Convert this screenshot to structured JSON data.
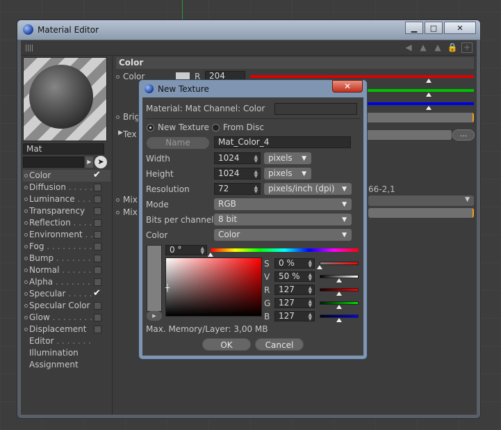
{
  "window": {
    "title": "Material Editor",
    "minimize_label": "▁",
    "maximize_label": "□",
    "close_label": "✕"
  },
  "material": {
    "name": "Mat",
    "channels": [
      {
        "label": "Color",
        "dots": "",
        "checkbox": true,
        "checked": true,
        "selected": true
      },
      {
        "label": "Diffusion",
        "dots": " . . . . . .",
        "checkbox": true,
        "checked": false
      },
      {
        "label": "Luminance",
        "dots": " . . . .",
        "checkbox": true,
        "checked": false
      },
      {
        "label": "Transparency",
        "dots": "",
        "checkbox": true,
        "checked": false
      },
      {
        "label": "Reflection",
        "dots": " . . . .",
        "checkbox": true,
        "checked": false
      },
      {
        "label": "Environment",
        "dots": " . .",
        "checkbox": true,
        "checked": false
      },
      {
        "label": "Fog",
        "dots": " . . . . . . . . .",
        "checkbox": true,
        "checked": false
      },
      {
        "label": "Bump",
        "dots": " . . . . . . .",
        "checkbox": true,
        "checked": false
      },
      {
        "label": "Normal",
        "dots": " . . . . . .",
        "checkbox": true,
        "checked": false
      },
      {
        "label": "Alpha",
        "dots": " . . . . . . .",
        "checkbox": true,
        "checked": false
      },
      {
        "label": "Specular",
        "dots": " . . . . .",
        "checkbox": true,
        "checked": true
      },
      {
        "label": "Specular Color",
        "dots": "",
        "checkbox": true,
        "checked": false
      },
      {
        "label": "Glow",
        "dots": " . . . . . . . .",
        "checkbox": true,
        "checked": false
      },
      {
        "label": "Displacement",
        "dots": "",
        "checkbox": true,
        "checked": false
      },
      {
        "label": "Editor",
        "dots": " . . . . . . .",
        "checkbox": false
      },
      {
        "label": "Illumination",
        "dots": "",
        "checkbox": false
      },
      {
        "label": "Assignment",
        "dots": "",
        "checkbox": false
      }
    ]
  },
  "attributes": {
    "section_title": "Color",
    "color_label": "Color",
    "r_label": "R",
    "r_value": "204",
    "brightness_label": "Brig",
    "texture_label": "Tex",
    "dots_button": "...",
    "mix_label_1": "Mix",
    "mix_label_2": "Mix",
    "partial_text": "66-2,1"
  },
  "dialog": {
    "title": "New Texture",
    "close_label": "✕",
    "material_label": "Material: Mat Channel: Color",
    "option_new": "New Texture",
    "option_disc": "From Disc",
    "selected_option": "New Texture",
    "name_button": "Name",
    "name_value": "Mat_Color_4",
    "width_label": "Width",
    "width_value": "1024",
    "width_unit": "pixels",
    "height_label": "Height",
    "height_value": "1024",
    "height_unit": "pixels",
    "resolution_label": "Resolution",
    "resolution_value": "72",
    "resolution_unit": "pixels/inch (dpi)",
    "mode_label": "Mode",
    "mode_value": "RGB",
    "bits_label": "Bits per channel",
    "bits_value": "8 bit",
    "color_label": "Color",
    "color_mode": "Color",
    "hue_value": "0 °",
    "s_label": "S",
    "s_value": "0 %",
    "v_label": "V",
    "v_value": "50 %",
    "r_label": "R",
    "r_value": "127",
    "g_label": "G",
    "g_value": "127",
    "b_label": "B",
    "b_value": "127",
    "memory_text": "Max. Memory/Layer: 3,00 MB",
    "ok_label": "OK",
    "cancel_label": "Cancel"
  },
  "colors": {
    "red_slider": "#e00000",
    "green_slider": "#00c000",
    "blue_slider": "#0000e0",
    "swatch_gray": "#7f7f7f",
    "accent_orange": "#f0a020"
  }
}
